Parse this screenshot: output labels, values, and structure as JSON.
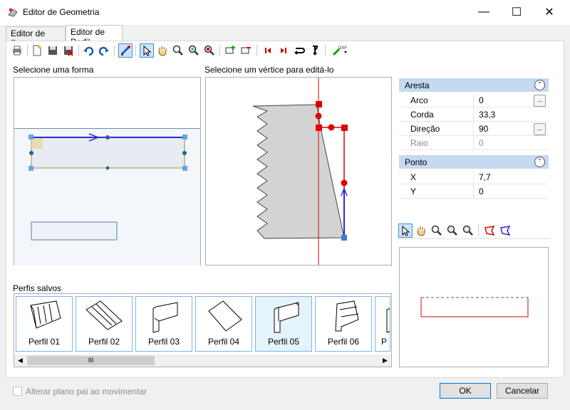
{
  "window": {
    "title": "Editor de Geometria",
    "minimize": "—",
    "maximize": "☐",
    "close": "✕"
  },
  "tabs": [
    {
      "label": "Editor de Forma"
    },
    {
      "label": "Editor de Perfil"
    }
  ],
  "toolbar": {
    "dxf_label": "DXF"
  },
  "shape_panel": {
    "label": "Selecione uma forma"
  },
  "vertex_panel": {
    "label": "Selecione um vértice para editá-lo"
  },
  "props": {
    "edge": {
      "header": "Aresta",
      "rows": [
        {
          "key": "Arco",
          "value": "0"
        },
        {
          "key": "Corda",
          "value": "33,3"
        },
        {
          "key": "Direção",
          "value": "90"
        },
        {
          "key": "Raio",
          "value": "0"
        }
      ]
    },
    "point": {
      "header": "Ponto",
      "rows": [
        {
          "key": "X",
          "value": "7,7"
        },
        {
          "key": "Y",
          "value": "0"
        }
      ]
    }
  },
  "saved_profiles": {
    "label": "Perfis salvos",
    "items": [
      {
        "label": "Perfil 01"
      },
      {
        "label": "Perfil 02"
      },
      {
        "label": "Perfil 03"
      },
      {
        "label": "Perfil 04"
      },
      {
        "label": "Perfil 05"
      },
      {
        "label": "Perfil 06"
      },
      {
        "label": "P"
      }
    ],
    "selected_index": 4,
    "scroll_grip": "III"
  },
  "footer": {
    "checkbox_label": "Alterar plano pai ao movimentar",
    "checkbox_checked": false,
    "ok_label": "OK",
    "cancel_label": "Cancelar"
  },
  "colors": {
    "accent": "#0078d7",
    "grid_header": "#c5d9f1",
    "vertex_red": "#e00000",
    "handle_blue": "#3c7dd9"
  }
}
